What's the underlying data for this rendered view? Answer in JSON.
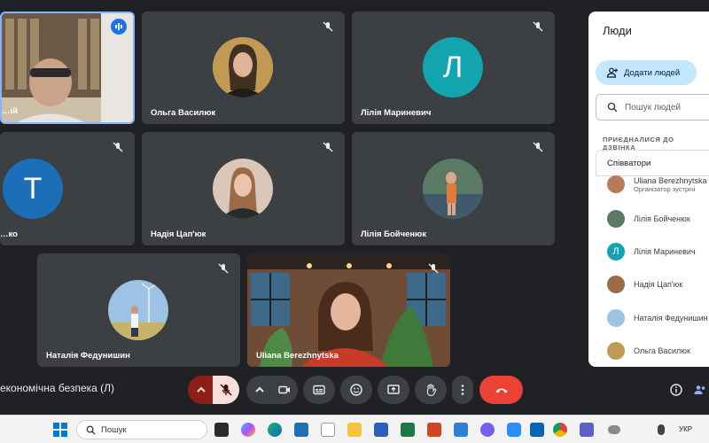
{
  "participants": [
    {
      "name": "…ій",
      "type": "photo",
      "speaking": true
    },
    {
      "name": "Ольга Василюк",
      "type": "photo"
    },
    {
      "name": "Лілія Мариневич",
      "type": "letter",
      "letter": "Л",
      "color": "#12a4af"
    },
    {
      "name": "…ко",
      "type": "letter",
      "letter": "Т",
      "color": "#1a6fb8"
    },
    {
      "name": "Надія Цап'юк",
      "type": "photo"
    },
    {
      "name": "Лілія Бойченюк",
      "type": "photo"
    },
    {
      "name": "Наталія Федунишин",
      "type": "photo"
    },
    {
      "name": "Uliana Berezhnytska",
      "type": "video"
    }
  ],
  "meeting": {
    "title": "економічна безпека (Л)"
  },
  "controls": [
    "mic-options",
    "mic-muted",
    "camera-options",
    "camera",
    "captions",
    "emoji",
    "present",
    "raise-hand",
    "more",
    "leave-call",
    "info",
    "people"
  ],
  "panel": {
    "title": "Люди",
    "add_label": "Додати людей",
    "search_placeholder": "Пошук людей",
    "section_label": "ПРИЄДНАЛИСЯ ДО ДЗВІНКА",
    "group_label": "Співватори",
    "people": [
      {
        "name": "Uliana Berezhnytska",
        "sub": "Організатор зустрічі"
      },
      {
        "name": "Лілія Бойченюк",
        "sub": ""
      },
      {
        "name": "Лілія Мариневич",
        "sub": ""
      },
      {
        "name": "Надія Цап'юк",
        "sub": ""
      },
      {
        "name": "Наталія Федунишин",
        "sub": ""
      },
      {
        "name": "Ольга Василюк",
        "sub": ""
      }
    ]
  },
  "taskbar": {
    "search_label": "Пошук",
    "lang": "УКР"
  },
  "colors": {
    "tile": "#3c4043",
    "accent": "#1a73e8",
    "leave": "#ea4335",
    "mute": "#f9dedc"
  }
}
